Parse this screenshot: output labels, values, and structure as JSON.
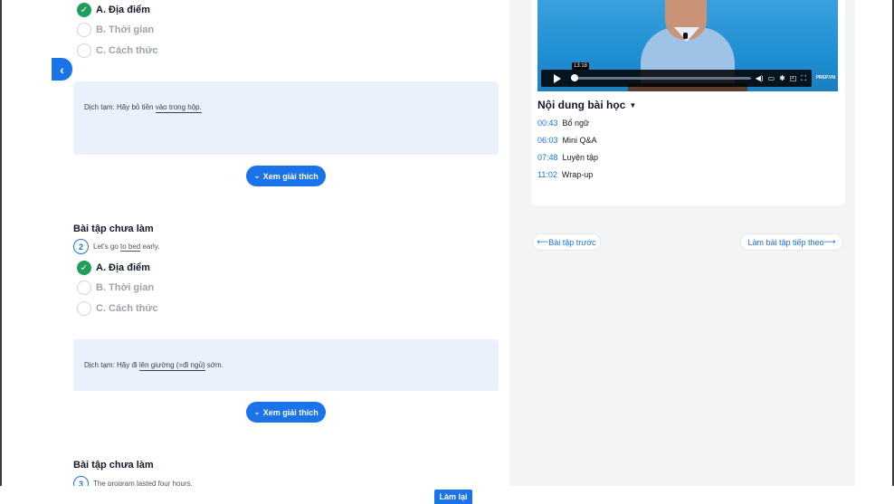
{
  "colors": {
    "accent": "#1a73e8",
    "correct": "#1e9e5a",
    "translation_bg": "#eaf0fc"
  },
  "exercise1": {
    "options": [
      {
        "label": "A. Địa điểm",
        "state": "correct"
      },
      {
        "label": "B. Thời gian",
        "state": "muted"
      },
      {
        "label": "C. Cách thức",
        "state": "muted"
      }
    ],
    "translation": {
      "prefix": "Dịch tạm: Hãy bỏ tiền ",
      "underlined": "vào trong hộp.",
      "suffix": ""
    },
    "explain_label": "Xem giải thích"
  },
  "exercise2": {
    "title": "Bài tập chưa làm",
    "number": "2",
    "question": {
      "prefix": "Let's go ",
      "underlined": "to bed",
      "suffix": " early."
    },
    "options": [
      {
        "label": "A. Địa điểm",
        "state": "correct"
      },
      {
        "label": "B. Thời gian",
        "state": "muted"
      },
      {
        "label": "C. Cách thức",
        "state": "muted"
      }
    ],
    "translation": {
      "prefix": "Dịch tạm: Hãy đi ",
      "underlined": "lên giường (=đi ngủ)",
      "suffix": " sớm."
    },
    "explain_label": "Xem giải thích"
  },
  "exercise3": {
    "title": "Bài tập chưa làm",
    "number": "3",
    "question": "The program lasted four hours."
  },
  "video": {
    "time_tooltip": "13:18",
    "progress": 0.02,
    "brand": "PREP.VN",
    "icons": [
      "play-icon",
      "volume-icon",
      "subtitles-icon",
      "settings-icon",
      "miniplayer-icon",
      "fullscreen-icon"
    ]
  },
  "toc": {
    "title": "Nội dung bài học",
    "items": [
      {
        "time": "00:43",
        "label": "Bổ ngữ"
      },
      {
        "time": "06:03",
        "label": "Mini Q&A"
      },
      {
        "time": "07:48",
        "label": "Luyện tập"
      },
      {
        "time": "11:02",
        "label": "Wrap-up"
      }
    ]
  },
  "nav": {
    "prev": "Bài tập trước",
    "next": "Làm bài tập tiếp theo"
  },
  "footer": {
    "redo": "Làm lại"
  }
}
